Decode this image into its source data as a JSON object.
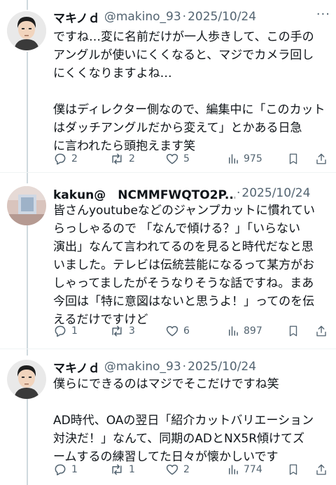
{
  "posts": [
    {
      "name": "マキノｄ",
      "handle": "@makino_93",
      "sep": "·",
      "date": "2025/10/24",
      "more": "···",
      "avatar": "man-avatar",
      "lines": [
        "ですね…変に名前だけが一人歩きして、この手の",
        "アングルが使いにくくなると、マジでカメラ回し",
        "にくくなりますよね…",
        "",
        "僕はディレクター側なので、編集中に「このカット",
        "はダッチアングルだから変えて」とかある日急",
        "に言われたら頭抱えます笑"
      ],
      "replies": "2",
      "reposts": "2",
      "likes": "5",
      "views": "975"
    },
    {
      "name": "kakun@　NCMMFWQTO2P...",
      "handle": "",
      "sep": "·",
      "date": "2025/10/24",
      "more": "",
      "avatar": "room-avatar",
      "lines": [
        "皆さんyoutubeなどのジャンプカットに慣れてい",
        "らっしゃるので 「なんで傾ける？」「いらない",
        "演出」なんて言われてるのを見ると時代だなと思",
        "いました。テレビは伝統芸能になるって某方がお",
        "しゃってましたがそうなりそうな話ですね。まあ",
        "今回は「特に意図はないと思うよ！」ってのを伝",
        "えるだけですけど"
      ],
      "replies": "1",
      "reposts": "3",
      "likes": "6",
      "views": "897"
    },
    {
      "name": "マキノｄ",
      "handle": "@makino_93",
      "sep": "·",
      "date": "2025/10/24",
      "more": "",
      "avatar": "man-avatar",
      "lines": [
        "僕らにできるのはマジでそこだけですね笑",
        "",
        "AD時代、OAの翌日「紹介カットバリエーション",
        "対決だ！」なんて、同期のADとNX5R傾けてズ",
        "ームするの練習してた日々が懐かしいです"
      ],
      "replies": "1",
      "reposts": "1",
      "likes": "2",
      "views": "774"
    }
  ],
  "icons": [
    "reply-icon",
    "repost-icon",
    "like-icon",
    "views-icon",
    "bookmark-icon",
    "share-icon"
  ],
  "colors": {
    "text": "#0f1419",
    "secondary": "#536471",
    "thread_line": "#cfd9de"
  }
}
